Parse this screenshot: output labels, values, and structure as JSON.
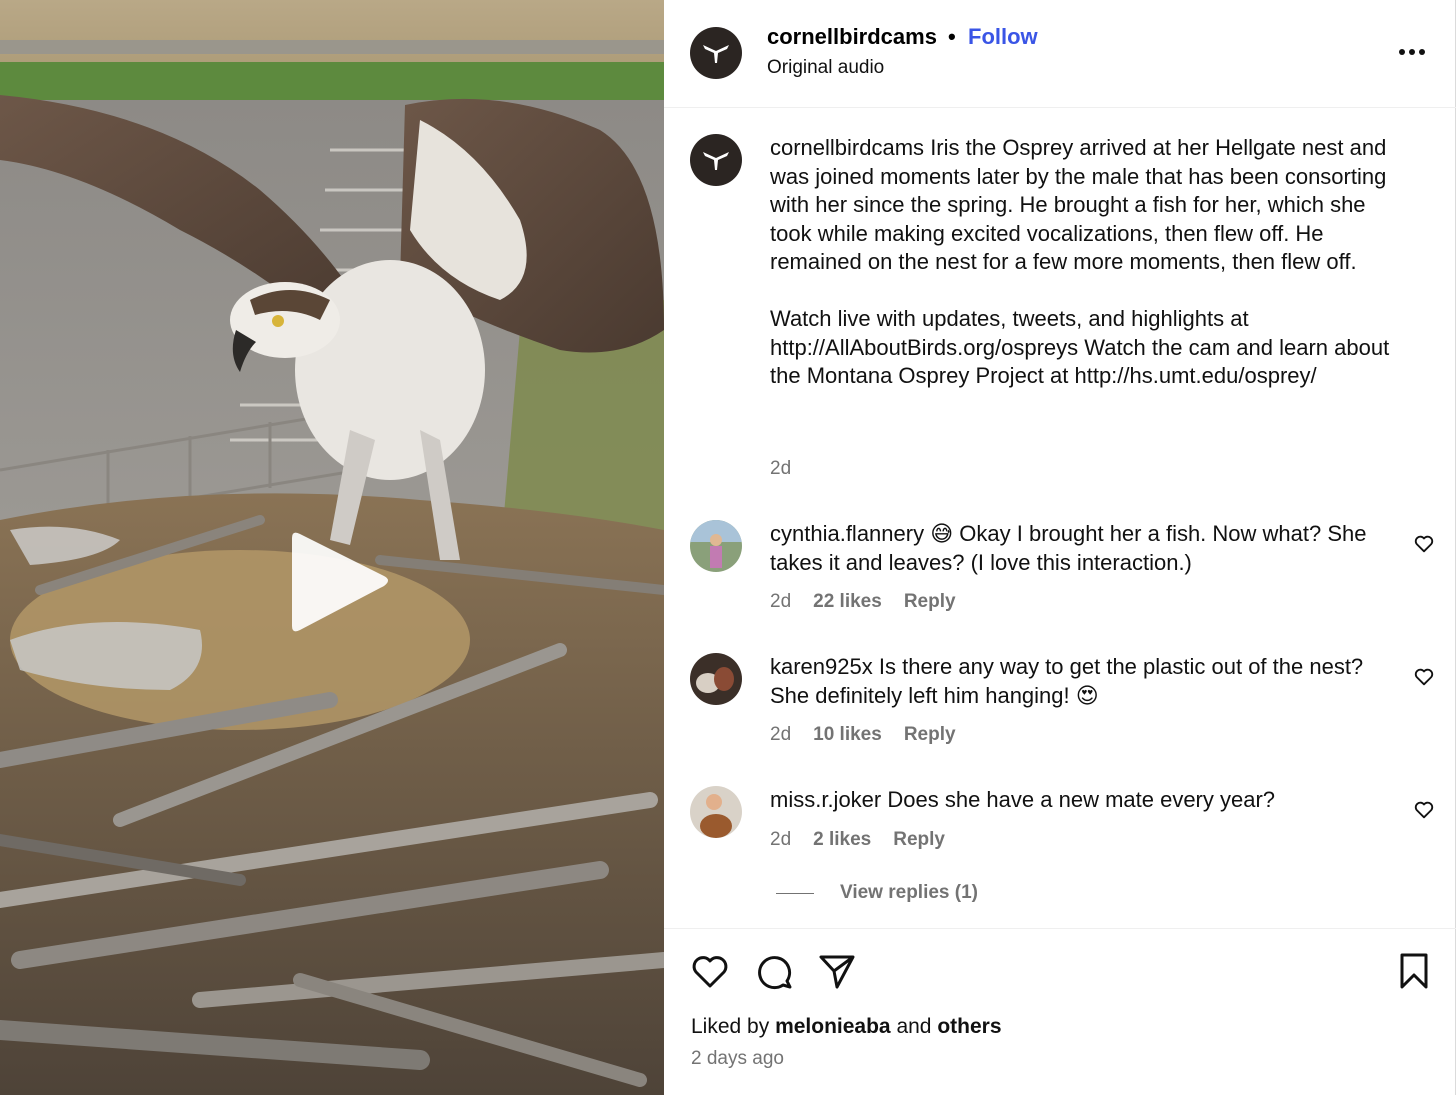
{
  "header": {
    "username": "cornellbirdcams",
    "separator": "•",
    "follow_label": "Follow",
    "audio_label": "Original audio",
    "more_icon": "more-horizontal-icon"
  },
  "caption": {
    "username": "cornellbirdcams",
    "paragraph1": "Iris the Osprey arrived at her Hellgate nest and was joined moments later by the male that has been consorting with her since the spring. He brought a fish for her, which she took while making excited vocalizations, then flew off. He remained on the nest for a few more moments, then flew off.",
    "paragraph2": "Watch live with updates, tweets, and highlights at http://AllAboutBirds.org/ospreys Watch the cam and learn about the Montana Osprey Project at http://hs.umt.edu/osprey/",
    "time": "2d"
  },
  "comments": [
    {
      "username": "cynthia.flannery",
      "emoji": "😅",
      "text": "Okay I brought her a fish. Now what? She takes it and leaves? (I love this interaction.)",
      "time": "2d",
      "likes": "22 likes",
      "reply_label": "Reply"
    },
    {
      "username": "karen925x",
      "text": "Is there any way to get the plastic out of the nest? She definitely left him hanging!",
      "emoji": "😍",
      "time": "2d",
      "likes": "10 likes",
      "reply_label": "Reply"
    },
    {
      "username": "miss.r.joker",
      "text": "Does she have a new mate every year?",
      "time": "2d",
      "likes": "2 likes",
      "reply_label": "Reply"
    }
  ],
  "view_replies_label": "View replies (1)",
  "footer": {
    "liked_prefix": "Liked by",
    "liked_user": "melonieaba",
    "liked_and": "and",
    "liked_others": "others",
    "time_ago": "2 days ago"
  },
  "colors": {
    "accent": "#3a55e6",
    "muted": "#737373",
    "border": "#efefef"
  },
  "icons": [
    "play-icon",
    "heart-icon",
    "comment-icon",
    "share-icon",
    "bookmark-icon",
    "more-horizontal-icon",
    "cornell-bird-logo-icon"
  ]
}
